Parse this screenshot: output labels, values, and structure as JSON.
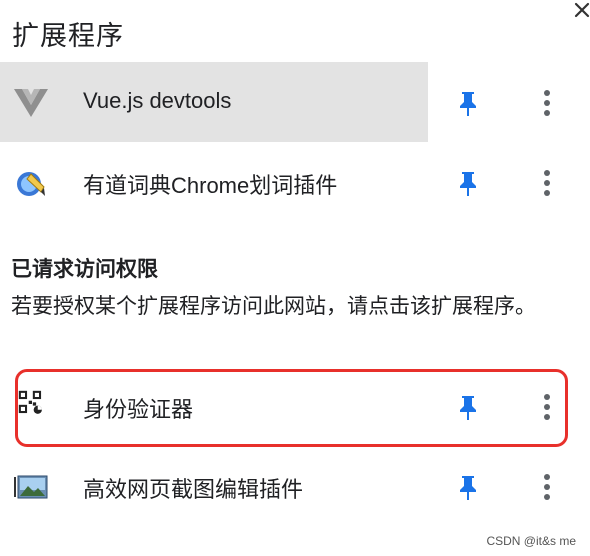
{
  "panel": {
    "title": "扩展程序"
  },
  "extensions_pinned": [
    {
      "name": "Vue.js devtools",
      "icon": "vue-logo-icon",
      "highlighted": true
    },
    {
      "name": "有道词典Chrome划词插件",
      "icon": "youdao-dict-icon",
      "highlighted": false
    }
  ],
  "access_section": {
    "title": "已请求访问权限",
    "description": "若要授权某个扩展程序访问此网站，请点击该扩展程序。"
  },
  "extensions_access": [
    {
      "name": "身份验证器",
      "icon": "qr-code-icon",
      "boxed": true
    },
    {
      "name": "高效网页截图编辑插件",
      "icon": "screenshot-image-icon"
    }
  ],
  "watermark": "CSDN @it&s me",
  "colors": {
    "pin": "#1a73e8",
    "highlight": "#e3e3e3",
    "annotation": "#e8302b",
    "icon": "#5f6368"
  }
}
